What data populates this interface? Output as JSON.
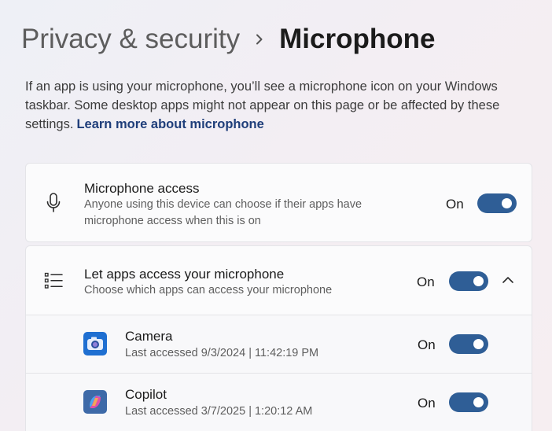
{
  "breadcrumb": {
    "parent": "Privacy & security",
    "separator_icon": "chevron-right-icon",
    "current": "Microphone"
  },
  "description": {
    "text": "If an app is using your microphone, you’ll see a microphone icon on your Windows taskbar. Some desktop apps might not appear on this page or be affected by these settings.",
    "link": "Learn more about microphone"
  },
  "microphone_access": {
    "icon": "microphone-icon",
    "title": "Microphone access",
    "subtitle_line1": "Anyone using this device can choose if their apps have",
    "subtitle_line2": "microphone access when this is on",
    "state": "On",
    "enabled": true
  },
  "apps_access": {
    "icon": "list-icon",
    "title": "Let apps access your microphone",
    "subtitle": "Choose which apps can access your microphone",
    "state": "On",
    "enabled": true,
    "expand_icon": "chevron-up-icon",
    "apps": [
      {
        "icon": "camera-app-icon",
        "name": "Camera",
        "last_accessed": "Last accessed 9/3/2024  |  11:42:19 PM",
        "state": "On",
        "enabled": true
      },
      {
        "icon": "copilot-app-icon",
        "name": "Copilot",
        "last_accessed": "Last accessed 3/7/2025  |  1:20:12 AM",
        "state": "On",
        "enabled": true
      }
    ]
  },
  "colors": {
    "accent": "#2f5e96",
    "link": "#1f3e7a"
  }
}
